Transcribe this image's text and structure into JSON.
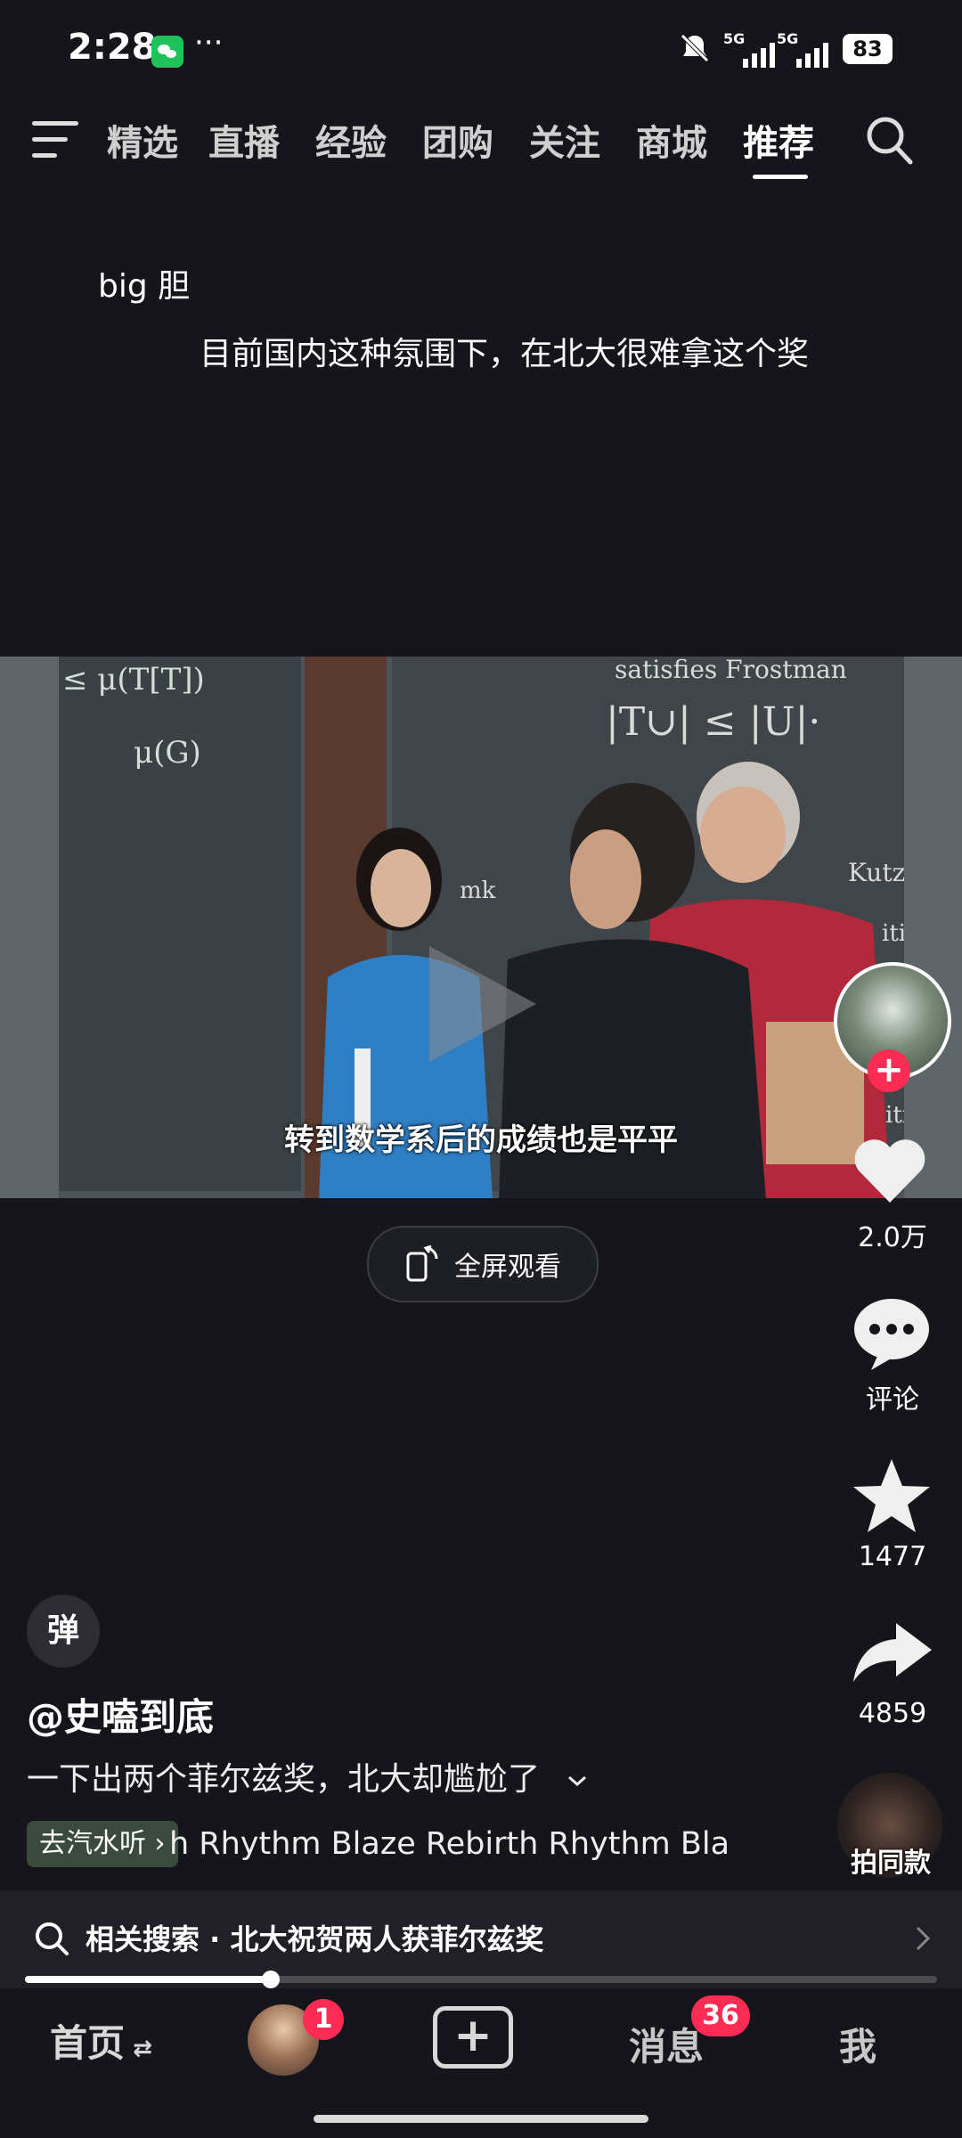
{
  "status_bar": {
    "time": "2:28",
    "dots": "···",
    "network1": "5G",
    "network2": "5G",
    "battery": "83"
  },
  "top_nav": {
    "tabs": [
      "精选",
      "直播",
      "经验",
      "团购",
      "关注",
      "商城",
      "推荐"
    ],
    "active_tab": "推荐"
  },
  "comments": [
    {
      "text": "big 胆"
    },
    {
      "text": "目前国内这种氛围下，在北大很难拿这个奖"
    }
  ],
  "video": {
    "subtitle": "转到数学系后的成绩也是平平",
    "board_text": [
      "satisfies Frostman",
      "|T∪| ≤ |U|·",
      "μ(G)",
      "≤ μ(T[T])",
      "mk",
      "Kutz",
      "iti",
      "itio"
    ]
  },
  "fullscreen_label": "全屏观看",
  "right_rail": {
    "likes": "2.0万",
    "comments_label": "评论",
    "favorites": "1477",
    "shares": "4859",
    "same_style_label": "拍同款"
  },
  "post": {
    "danmu_toggle": "弹",
    "author": "@史嗑到底",
    "caption": "一下出两个菲尔兹奖，北大却尴尬了",
    "music_tag": "去汽水听",
    "music_scroll": "h Rhythm Blaze    Rebirth Rhythm Bla"
  },
  "related_search": {
    "label": "相关搜索 · 北大祝贺两人获菲尔兹奖"
  },
  "playback_progress": 0.27,
  "bottom_nav": {
    "home": "首页",
    "friends_badge": "1",
    "messages": "消息",
    "messages_badge": "36",
    "me": "我"
  }
}
